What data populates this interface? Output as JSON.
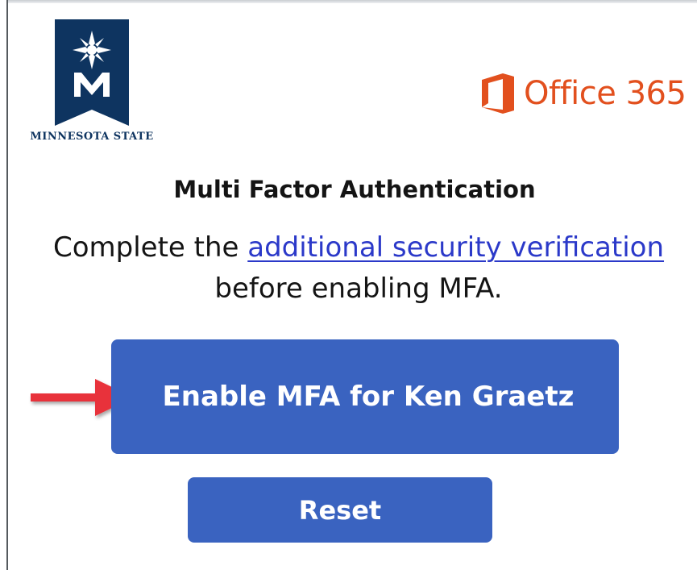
{
  "logos": {
    "left": {
      "icon": "minnesota-state-star-m-icon",
      "text": "MINNESOTA STATE",
      "colors": {
        "banner": "#0e3460",
        "star": "#ffffff"
      }
    },
    "right": {
      "icon": "office-365-icon",
      "text": "Office 365",
      "color": "#e2501e"
    }
  },
  "main": {
    "heading": "Multi Factor Authentication",
    "message": {
      "prefix": "Complete the ",
      "link_text": "additional security verification",
      "suffix": " before enabling MFA."
    }
  },
  "buttons": {
    "enable_label": "Enable MFA for Ken Graetz",
    "reset_label": "Reset",
    "color": "#3a63c0"
  },
  "annotation": {
    "icon": "red-arrow-icon",
    "color": "#e8333a"
  }
}
